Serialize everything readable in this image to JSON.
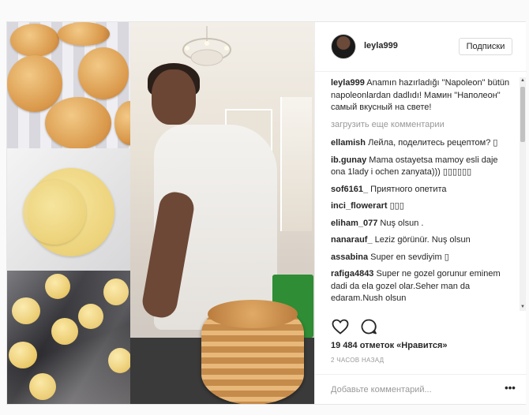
{
  "post": {
    "username": "leyla999",
    "follow_label": "Подписки",
    "caption_user": "leyla999",
    "caption_text": "Anamın hazırladığı \"Napoleon\" bütün napoleonlardan dadlıdı! Мамин \"Наполеон\" самый вкусный на свете!",
    "load_more": "загрузить еще комментарии",
    "comments": [
      {
        "user": "ellamish",
        "text": "Лейла, поделитесь рецептом? ▯"
      },
      {
        "user": "ib.gunay",
        "text": "Mama ostayetsa mamoy esli daje ona 1lady i ochen zanyata))) ▯▯▯▯▯▯"
      },
      {
        "user": "sof6161_",
        "text": "Приятного опетита"
      },
      {
        "user": "inci_flowerart",
        "text": "▯▯▯"
      },
      {
        "user": "eliham_077",
        "text": "Nuş olsun ."
      },
      {
        "user": "nanarauf_",
        "text": "Leziz görünür. Nuş olsun"
      },
      {
        "user": "assabina",
        "text": "Super en sevdiyim ▯"
      },
      {
        "user": "rafiga4843",
        "text": "Super ne gozel gorunur eminem dadi da ela gozel olar.Seher man da edaram.Nush olsun"
      }
    ],
    "likes": "19 484 отметок «Нравится»",
    "time": "2 ЧАСОВ НАЗАД",
    "add_comment_placeholder": "Добавьте комментарий...",
    "more_label": "•••",
    "icons": {
      "like": "heart-icon",
      "comment": "comment-bubble-icon",
      "more": "more-options-icon"
    }
  },
  "colors": {
    "text": "#262626",
    "muted": "#999999",
    "border": "#efefef",
    "bag_green": "#2e8d35"
  }
}
